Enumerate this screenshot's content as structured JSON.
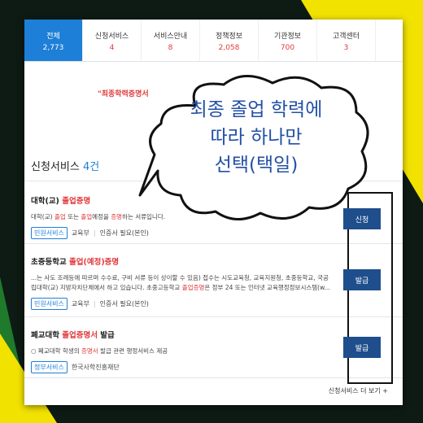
{
  "tabs": [
    {
      "label": "전체",
      "count": "2,773"
    },
    {
      "label": "신청서비스",
      "count": "4"
    },
    {
      "label": "서비스안내",
      "count": "8"
    },
    {
      "label": "정책정보",
      "count": "2,058"
    },
    {
      "label": "기관정보",
      "count": "700"
    },
    {
      "label": "고객센터",
      "count": "3"
    }
  ],
  "notice": "\"최종학력증명서",
  "section": {
    "title": "신청서비스",
    "count": "4건"
  },
  "items": [
    {
      "title_pre": "대학(교) ",
      "title_hl": "졸업증명",
      "desc_parts": [
        "대학(교) ",
        "졸업",
        " 또는 ",
        "졸업",
        "예정을 ",
        "증명",
        "하는 서류입니다."
      ],
      "badge": "민원서비스",
      "org": "교육부",
      "cert": "인증서 필요(본인)",
      "button": "신청"
    },
    {
      "title_pre": "초중등학교 ",
      "title_hl": "졸업(예정)",
      "title_post": "증명",
      "desc1": "...는 사도 조례등에 따르며 수수료, 구비 서류 등이 상이할 수 있음) 접수는 시도교육청, 교육지원청, 초중등학교, 국공",
      "desc2_pre": "립대학(교) 지방자치단체에서 하고 있습니다. 초중고등학교 ",
      "desc2_hl": "졸업증명",
      "desc2_post": "은 정부 24 또는 인터넷 교육행정정보시스템(w...",
      "badge": "민원서비스",
      "org": "교육부",
      "cert": "인증서 필요(본인)",
      "button": "발급"
    },
    {
      "title_pre": "폐교대학 ",
      "title_hl": "졸업증명서",
      "title_post": " 발급",
      "desc_pre": "○ 폐교대학 학생의 ",
      "desc_hl": "증명서",
      "desc_post": " 발급 관련 행정서비스 제공",
      "badge": "정부서비스",
      "org": "한국사학진흥재단",
      "button": "발급"
    }
  ],
  "more": "신청서비스 더 보기  +",
  "bubble": {
    "line1": "최종 졸업 학력에",
    "line2": "따라 하나만",
    "line3": "선택(택일)"
  },
  "colors": {
    "accent": "#1e7fd8",
    "highlight": "#e2383a",
    "button": "#1f4e8c",
    "bubble_text": "#2350a6"
  }
}
